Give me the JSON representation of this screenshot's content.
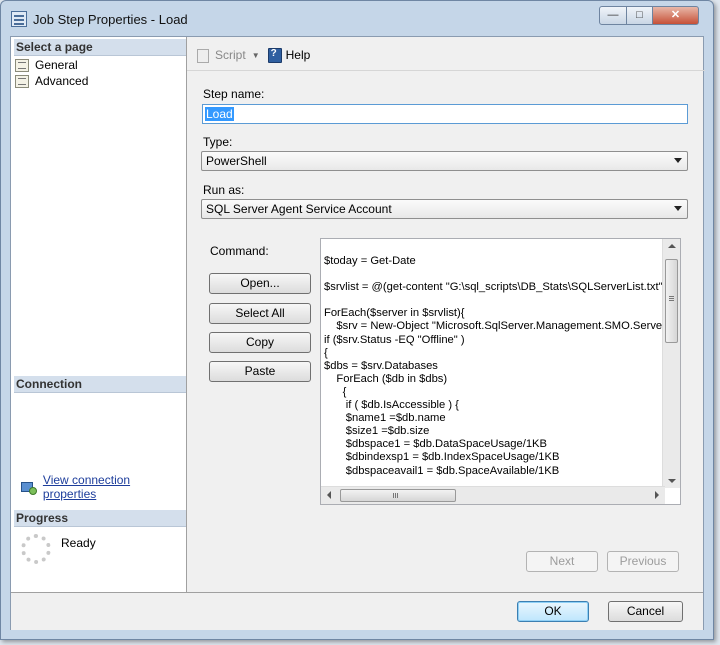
{
  "window": {
    "title": "Job Step Properties - Load"
  },
  "left_panel": {
    "select_page_header": "Select a page",
    "pages": [
      {
        "label": "General",
        "icon": "page-icon"
      },
      {
        "label": "Advanced",
        "icon": "page-icon"
      }
    ],
    "connection_header": "Connection",
    "connection_link": "View connection properties",
    "progress_header": "Progress",
    "progress_status": "Ready"
  },
  "toolbar": {
    "script_label": "Script",
    "help_label": "Help"
  },
  "form": {
    "step_name_label": "Step name:",
    "step_name_value": "Load",
    "type_label": "Type:",
    "type_value": "PowerShell",
    "run_as_label": "Run as:",
    "run_as_value": "SQL Server Agent Service Account",
    "command_label": "Command:",
    "command_buttons": [
      "Open...",
      "Select All",
      "Copy",
      "Paste"
    ],
    "command_text": "$today = Get-Date\n\n$srvlist = @(get-content \"G:\\sql_scripts\\DB_Stats\\SQLServerList.txt\")\n\nForEach($server in $srvlist){\n    $srv = New-Object \"Microsoft.SqlServer.Management.SMO.Server\" $\nif ($srv.Status -EQ \"Offline\" )\n{\n$dbs = $srv.Databases\n    ForEach ($db in $dbs)\n      {\n       if ( $db.IsAccessible ) {\n       $name1 =$db.name\n       $size1 =$db.size\n       $dbspace1 = $db.DataSpaceUsage/1KB\n       $dbindexsp1 = $db.IndexSpaceUsage/1KB\n       $dbspaceavail1 = $db.SpaceAvailable/1KB"
  },
  "nav": {
    "next_label": "Next",
    "previous_label": "Previous"
  },
  "footer": {
    "ok_label": "OK",
    "cancel_label": "Cancel"
  }
}
